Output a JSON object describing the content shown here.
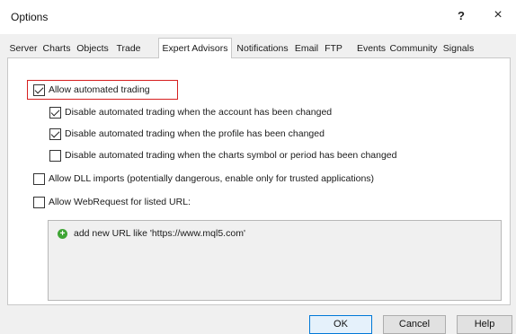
{
  "window": {
    "title": "Options",
    "help": "?",
    "close": "×"
  },
  "tabs": [
    {
      "label": "Server"
    },
    {
      "label": "Charts"
    },
    {
      "label": "Objects"
    },
    {
      "label": "Trade"
    },
    {
      "label": "Expert Advisors",
      "active": true
    },
    {
      "label": "Notifications"
    },
    {
      "label": "Email"
    },
    {
      "label": "FTP"
    },
    {
      "label": "Events"
    },
    {
      "label": "Community"
    },
    {
      "label": "Signals"
    }
  ],
  "options": {
    "allow_auto": {
      "label": "Allow automated trading",
      "checked": true
    },
    "disable_account": {
      "label": "Disable automated trading when the account has been changed",
      "checked": true
    },
    "disable_profile": {
      "label": "Disable automated trading when the profile has been changed",
      "checked": true
    },
    "disable_symbol": {
      "label": "Disable automated trading when the charts symbol or period has been changed",
      "checked": false
    },
    "allow_dll": {
      "label": "Allow DLL imports (potentially dangerous, enable only for trusted applications)",
      "checked": false
    },
    "allow_webrequest": {
      "label": "Allow WebRequest for listed URL:",
      "checked": false
    }
  },
  "url_list": {
    "add_item": "add new URL like 'https://www.mql5.com'"
  },
  "buttons": {
    "ok": "OK",
    "cancel": "Cancel",
    "help": "Help"
  },
  "colors": {
    "highlight": "#d62020",
    "default_button": "#0078d7",
    "add_icon": "#3fa535"
  }
}
